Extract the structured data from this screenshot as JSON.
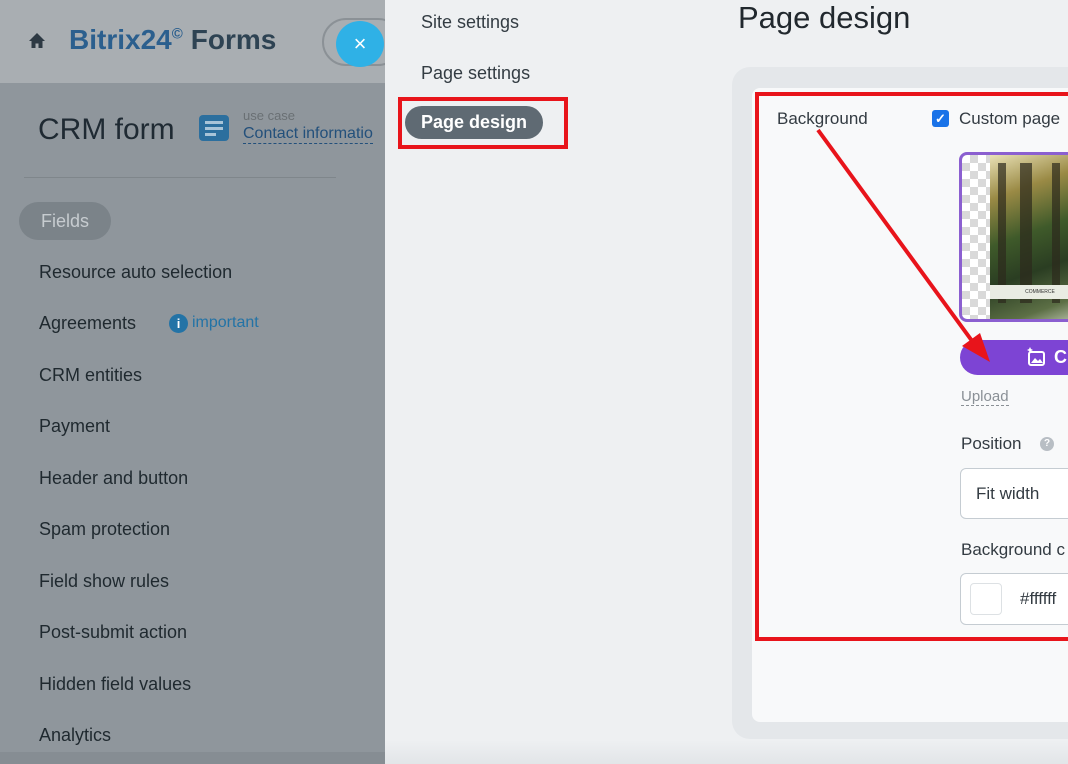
{
  "header": {
    "brand": "Bitrix24",
    "brand_mark": "©",
    "product": "Forms",
    "close_glyph": "×"
  },
  "form": {
    "title": "CRM form",
    "use_case_label": "use case",
    "use_case_link": "Contact informatio"
  },
  "left_menu": {
    "active": "Fields",
    "items": [
      "Resource auto selection",
      "Agreements",
      "CRM entities",
      "Payment",
      "Header and button",
      "Spam protection",
      "Field show rules",
      "Post-submit action",
      "Hidden field values",
      "Analytics"
    ],
    "important_badge": "important",
    "info_glyph": "i"
  },
  "settings_nav": {
    "items": [
      "Site settings",
      "Page settings"
    ],
    "active": "Page design"
  },
  "content": {
    "title": "Page design",
    "background_label": "Background",
    "custom_checkbox_label": "Custom page",
    "checkbox_checked": true,
    "button_partial_label": "C",
    "upload_link": "Upload",
    "position_label": "Position",
    "position_value": "Fit width",
    "help_glyph": "?",
    "background_color_label": "Background c",
    "background_color_value": "#ffffff",
    "thumbnail_caption": "COMMERCE"
  },
  "colors": {
    "annotation_red": "#e8141b",
    "button_purple": "#7d44d4",
    "close_blue": "#2fb1e6",
    "brand_blue": "#2b5f8e"
  },
  "icons": [
    "home-icon",
    "close-icon",
    "document-icon",
    "info-icon",
    "checkbox-checked-icon",
    "image-magic-icon",
    "help-icon"
  ]
}
